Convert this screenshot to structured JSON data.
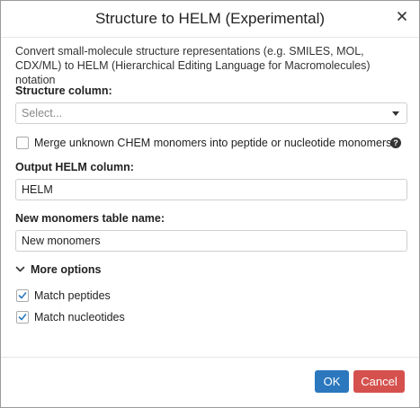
{
  "dialog": {
    "title": "Structure to HELM (Experimental)",
    "close_icon": "close-icon",
    "description": "Convert small-molecule structure representations (e.g. SMILES, MOL, CDX/ML) to HELM (Hierarchical Editing Language for Macromolecules) notation"
  },
  "structure_column": {
    "label": "Structure column:",
    "placeholder": "Select..."
  },
  "merge_chem": {
    "label": "Merge unknown CHEM monomers into peptide or nucleotide monomers",
    "checked": false,
    "help_icon": "help-icon"
  },
  "output_helm": {
    "label": "Output HELM column:",
    "value": "HELM"
  },
  "new_monomers": {
    "label": "New monomers table name:",
    "value": "New monomers"
  },
  "more_options": {
    "label": "More options",
    "expanded": true
  },
  "match_peptides": {
    "label": "Match peptides",
    "checked": true
  },
  "match_nucleotides": {
    "label": "Match nucleotides",
    "checked": true
  },
  "footer": {
    "ok_label": "OK",
    "cancel_label": "Cancel"
  },
  "colors": {
    "ok": "#2b78be",
    "cancel": "#d5514e"
  }
}
